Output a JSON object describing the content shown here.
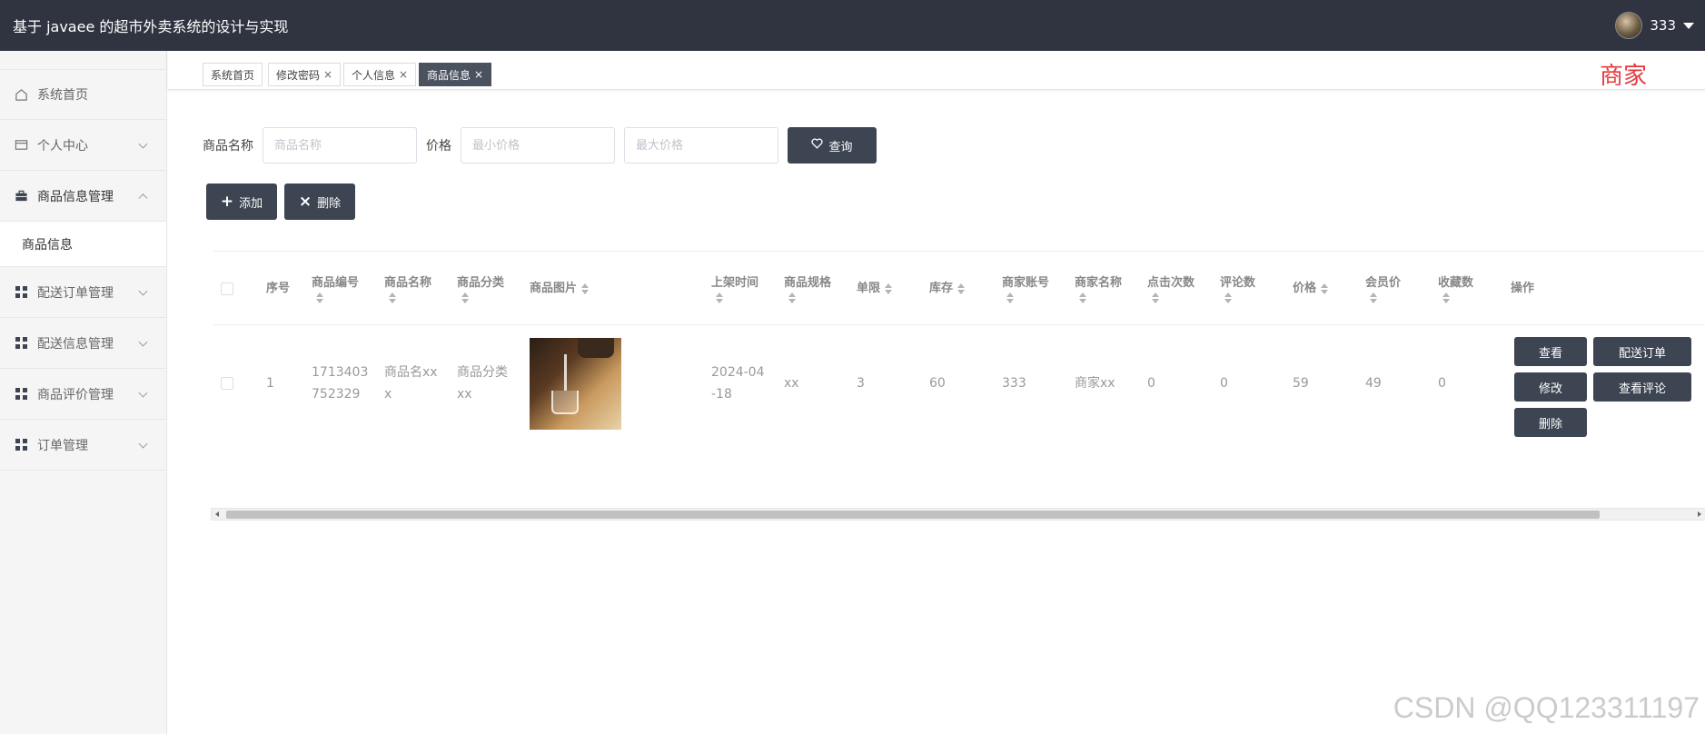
{
  "header": {
    "title": "基于 javaee 的超市外卖系统的设计与实现",
    "username": "333"
  },
  "sidebar": {
    "items": [
      {
        "label": "系统首页",
        "icon": "home-icon"
      },
      {
        "label": "个人中心",
        "icon": "card-icon"
      },
      {
        "label": "商品信息管理",
        "icon": "briefcase-icon"
      },
      {
        "label": "配送订单管理",
        "icon": "grid-icon"
      },
      {
        "label": "配送信息管理",
        "icon": "grid-icon"
      },
      {
        "label": "商品评价管理",
        "icon": "grid-icon"
      },
      {
        "label": "订单管理",
        "icon": "grid-icon"
      }
    ],
    "submenu": {
      "label": "商品信息"
    }
  },
  "tabs": [
    {
      "label": "系统首页",
      "closable": false
    },
    {
      "label": "修改密码",
      "closable": true
    },
    {
      "label": "个人信息",
      "closable": true
    },
    {
      "label": "商品信息",
      "closable": true,
      "active": true
    }
  ],
  "tab_close": "×",
  "role_label": "商家",
  "search": {
    "name_label": "商品名称",
    "name_placeholder": "商品名称",
    "price_label": "价格",
    "min_placeholder": "最小价格",
    "max_placeholder": "最大价格",
    "query_label": "查询"
  },
  "actions": {
    "add_label": "添加",
    "delete_label": "删除"
  },
  "table": {
    "headers": {
      "seq": "序号",
      "code": "商品编号",
      "name": "商品名称",
      "category": "商品分类",
      "image": "商品图片",
      "shelf_time": "上架时间",
      "spec": "商品规格",
      "limit": "单限",
      "stock": "库存",
      "merchant_account": "商家账号",
      "merchant_name": "商家名称",
      "clicks": "点击次数",
      "reviews": "评论数",
      "price": "价格",
      "member_price": "会员价",
      "favorites": "收藏数",
      "ops": "操作"
    },
    "rows": [
      {
        "seq": "1",
        "code_l1": "1713403",
        "code_l2": "752329",
        "name_l1": "商品名xx",
        "name_l2": "x",
        "category_l1": "商品分类",
        "category_l2": "xx",
        "shelf_l1": "2024-04",
        "shelf_l2": "-18",
        "spec": "xx",
        "limit": "3",
        "stock": "60",
        "merchant_account": "333",
        "merchant_name": "商家xx",
        "clicks": "0",
        "reviews": "0",
        "price": "59",
        "member_price": "49",
        "favorites": "0"
      }
    ],
    "row_buttons": {
      "view": "查看",
      "delivery_order": "配送订单",
      "edit": "修改",
      "view_reviews": "查看评论",
      "delete": "删除"
    }
  },
  "watermark": "CSDN @QQ123311197"
}
